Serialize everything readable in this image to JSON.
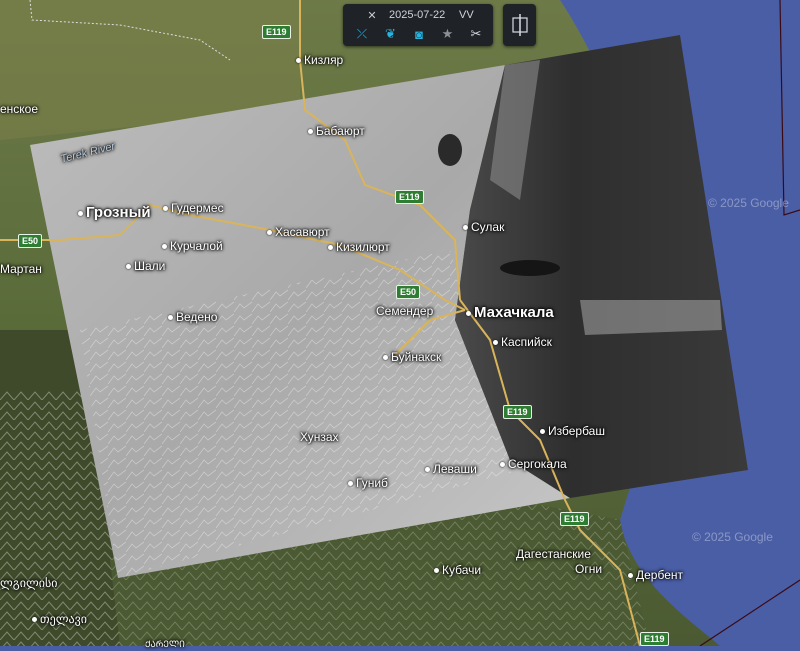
{
  "toolbar": {
    "expand_icon": "expand-icon",
    "date": "2025-07-22",
    "polarization": "VV",
    "tools": [
      {
        "name": "expand-tool-icon",
        "glyph": "⤫"
      },
      {
        "name": "drop-icon",
        "glyph": "❦"
      },
      {
        "name": "camera-icon",
        "glyph": "◙"
      },
      {
        "name": "star-icon",
        "glyph": "★"
      },
      {
        "name": "scissors-icon",
        "glyph": "✂"
      }
    ],
    "compare_icon": "compare-swipe-icon"
  },
  "colors": {
    "sea": "#4a5ea6",
    "land": "#5e6a3e",
    "road": "#d9b45a",
    "highway_shield": "#2e7d32",
    "accent_icon": "#27b5e0"
  },
  "places": [
    {
      "key": "kizlyar",
      "text": "Кизляр"
    },
    {
      "key": "babayurt",
      "text": "Бабаюрт"
    },
    {
      "key": "enskoe",
      "text": "енское"
    },
    {
      "key": "terek",
      "text": "Terek River"
    },
    {
      "key": "grozny",
      "text": "Грозный"
    },
    {
      "key": "gudermes",
      "text": "Гудермес"
    },
    {
      "key": "khasavyurt",
      "text": "Хасавюрт"
    },
    {
      "key": "kizilyurt",
      "text": "Кизилюрт"
    },
    {
      "key": "sulak",
      "text": "Сулак"
    },
    {
      "key": "kurchaloy",
      "text": "Курчалой"
    },
    {
      "key": "martan",
      "text": "Мартан"
    },
    {
      "key": "shali",
      "text": "Шали"
    },
    {
      "key": "vedeno",
      "text": "Ведено"
    },
    {
      "key": "semender",
      "text": "Семендер"
    },
    {
      "key": "makhachkala",
      "text": "Махачкала"
    },
    {
      "key": "kaspiysk",
      "text": "Каспийск"
    },
    {
      "key": "buynaksk",
      "text": "Буйнакск"
    },
    {
      "key": "izberbash",
      "text": "Избербаш"
    },
    {
      "key": "khunzakh",
      "text": "Хунзах"
    },
    {
      "key": "levashi",
      "text": "Леваши"
    },
    {
      "key": "sergokala",
      "text": "Сергокала"
    },
    {
      "key": "gunib",
      "text": "Гуниб"
    },
    {
      "key": "dagogni1",
      "text": "Дагестанские"
    },
    {
      "key": "dagogni2",
      "text": "Огни"
    },
    {
      "key": "kubachi",
      "text": "Кубачи"
    },
    {
      "key": "derbent",
      "text": "Дербент"
    },
    {
      "key": "tbilisi1",
      "text": "ლგილისი"
    },
    {
      "key": "georgian2",
      "text": "თელავი"
    },
    {
      "key": "georgian3",
      "text": "ᲥᲐᲠᲔᲚᲘ"
    }
  ],
  "roads": [
    {
      "key": "e119a",
      "text": "E119"
    },
    {
      "key": "e119b",
      "text": "E119"
    },
    {
      "key": "e50a",
      "text": "E50"
    },
    {
      "key": "e50b",
      "text": "E50"
    },
    {
      "key": "e119c",
      "text": "E119"
    },
    {
      "key": "e119d",
      "text": "E119"
    },
    {
      "key": "e119e",
      "text": "E119"
    }
  ],
  "watermarks": [
    {
      "key": "wm1",
      "text": "© 2025 Google"
    },
    {
      "key": "wm2",
      "text": "© 2025 Google"
    }
  ]
}
